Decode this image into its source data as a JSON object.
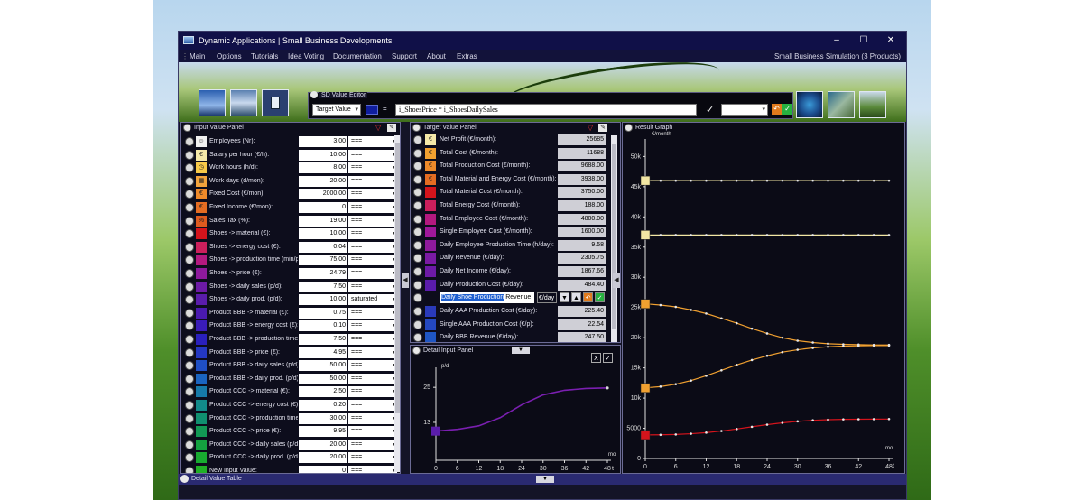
{
  "window": {
    "title": "Dynamic Applications | Small Business Developments",
    "minimize": "–",
    "maximize": "☐",
    "close": "✕"
  },
  "menu": {
    "items": [
      "Main",
      "Options",
      "Tutorials",
      "Idea Voting",
      "Documentation",
      "Support",
      "About",
      "Extras"
    ],
    "simulation": "Small Business Simulation  (3 Products)"
  },
  "sd_editor": {
    "label": "SD Value Editor",
    "target": "Target Value",
    "eq": "=",
    "formula": "i_ShoesPrice * i_ShoesDailySales",
    "check": "✓"
  },
  "input_panel": {
    "title": "Input Value Panel",
    "rows": [
      {
        "name": "Employees (Nr):",
        "value": "3.00",
        "op": "===",
        "color": "#f0f0f0",
        "glyph": "☺"
      },
      {
        "name": "Salary per hour (€/h):",
        "value": "10.00",
        "op": "===",
        "color": "#f5e9a8",
        "glyph": "€"
      },
      {
        "name": "Work hours (h/d):",
        "value": "8.00",
        "op": "===",
        "color": "#f7c948",
        "glyph": "◷"
      },
      {
        "name": "Work days (d/mon):",
        "value": "20.00",
        "op": "===",
        "color": "#f3a43c",
        "glyph": "▦"
      },
      {
        "name": "Fixed Cost (€/mon):",
        "value": "2000.00",
        "op": "===",
        "color": "#ee8a2a",
        "glyph": "€"
      },
      {
        "name": "Fixed Income (€/mon):",
        "value": "0",
        "op": "===",
        "color": "#e46c22",
        "glyph": "€"
      },
      {
        "name": "Sales Tax (%):",
        "value": "19.00",
        "op": "===",
        "color": "#dd5a1e",
        "glyph": "%"
      },
      {
        "name": "Shoes -> material (€):",
        "value": "10.00",
        "op": "===",
        "color": "#d4141c",
        "glyph": ""
      },
      {
        "name": "Shoes -> energy cost (€):",
        "value": "0.04",
        "op": "===",
        "color": "#cc1f5c",
        "glyph": ""
      },
      {
        "name": "Shoes -> production time (min/p",
        "value": "75.00",
        "op": "===",
        "color": "#b3197f",
        "glyph": ""
      },
      {
        "name": "Shoes -> price (€):",
        "value": "24.79",
        "op": "===",
        "color": "#8e1a9c",
        "glyph": ""
      },
      {
        "name": "Shoes -> daily sales (p/d):",
        "value": "7.50",
        "op": "===",
        "color": "#6d1aa6",
        "glyph": ""
      },
      {
        "name": "Shoes -> daily prod. (p/d):",
        "value": "10.00",
        "op": "saturated",
        "color": "#5a1cab",
        "glyph": ""
      },
      {
        "name": "Product BBB -> material (€):",
        "value": "0.75",
        "op": "===",
        "color": "#4a1ab0",
        "glyph": ""
      },
      {
        "name": "Product BBB -> energy cost (€):",
        "value": "0.10",
        "op": "===",
        "color": "#3a1cb8",
        "glyph": ""
      },
      {
        "name": "Product BBB -> production time",
        "value": "7.50",
        "op": "===",
        "color": "#2a20bd",
        "glyph": ""
      },
      {
        "name": "Product BBB -> price (€):",
        "value": "4.95",
        "op": "===",
        "color": "#2438c2",
        "glyph": ""
      },
      {
        "name": "Product BBB -> daily sales (p/d)",
        "value": "50.00",
        "op": "===",
        "color": "#1f4fc4",
        "glyph": ""
      },
      {
        "name": "Product BBB -> daily prod. (p/d)",
        "value": "50.00",
        "op": "===",
        "color": "#1a64c0",
        "glyph": ""
      },
      {
        "name": "Product CCC -> material (€):",
        "value": "2.50",
        "op": "===",
        "color": "#167aa8",
        "glyph": ""
      },
      {
        "name": "Product CCC -> energy cost (€):",
        "value": "0.20",
        "op": "===",
        "color": "#128a8a",
        "glyph": ""
      },
      {
        "name": "Product CCC -> production time",
        "value": "30.00",
        "op": "===",
        "color": "#109070",
        "glyph": ""
      },
      {
        "name": "Product CCC -> price (€):",
        "value": "9.95",
        "op": "===",
        "color": "#129a55",
        "glyph": ""
      },
      {
        "name": "Product CCC -> daily sales (p/d)",
        "value": "20.00",
        "op": "===",
        "color": "#14a240",
        "glyph": ""
      },
      {
        "name": "Product CCC -> daily prod. (p/d)",
        "value": "20.00",
        "op": "===",
        "color": "#18aa30",
        "glyph": ""
      },
      {
        "name": "New Input Value:",
        "value": "0",
        "op": "===",
        "color": "#20b026",
        "glyph": ""
      }
    ]
  },
  "target_panel": {
    "title": "Target Value Panel",
    "rows": [
      {
        "name": "Net Profit (€/month):",
        "value": "25685",
        "color": "#f5e9a8",
        "glyph": "€"
      },
      {
        "name": "Total Cost (€/month):",
        "value": "11688",
        "color": "#f0a030",
        "glyph": "€"
      },
      {
        "name": "Total Production Cost (€/month):",
        "value": "9688.00",
        "color": "#ee8a2a",
        "glyph": "€"
      },
      {
        "name": "Total Material and Energy Cost (€/month):",
        "value": "3938.00",
        "color": "#e46c22",
        "glyph": "€"
      },
      {
        "name": "Total Material Cost (€/month):",
        "value": "3750.00",
        "color": "#d4141c",
        "glyph": ""
      },
      {
        "name": "Total Energy Cost (€/month):",
        "value": "188.00",
        "color": "#cc1f5c",
        "glyph": ""
      },
      {
        "name": "Total Employee Cost (€/month):",
        "value": "4800.00",
        "color": "#b3197f",
        "glyph": ""
      },
      {
        "name": "Single Employee Cost (€/month):",
        "value": "1600.00",
        "color": "#a0189a",
        "glyph": ""
      },
      {
        "name": "Daily Employee Production Time (h/day):",
        "value": "9.58",
        "color": "#8e1a9c",
        "glyph": ""
      },
      {
        "name": "Daily Revenue (€/day):",
        "value": "2305.75",
        "color": "#7a1aa3",
        "glyph": ""
      },
      {
        "name": "Daily Net Income (€/day):",
        "value": "1867.66",
        "color": "#6d1aa6",
        "glyph": ""
      },
      {
        "name": "Daily Production Cost (€/day):",
        "value": "484.40",
        "color": "#5a1cab",
        "glyph": ""
      }
    ],
    "edit_row": {
      "highlight": "Daily Shoe Production",
      "rest": " Revenue",
      "unit": "€/day"
    },
    "rows2": [
      {
        "name": "Daily AAA Production Cost (€/day):",
        "value": "225.40",
        "color": "#2a3aba",
        "glyph": ""
      },
      {
        "name": "Single AAA Production Cost (€/p):",
        "value": "22.54",
        "color": "#2448c0",
        "glyph": ""
      },
      {
        "name": "Daily BBB Revenue (€/day):",
        "value": "247.50",
        "color": "#1f56c4",
        "glyph": ""
      }
    ]
  },
  "detail_input": {
    "title": "Detail Input Panel",
    "btn_x": "X",
    "btn_check": "✓",
    "unit": "p/d",
    "x_unit": "mo",
    "x_var": "t",
    "y_ticks": [
      "25",
      "13"
    ],
    "x_ticks": [
      "0",
      "6",
      "12",
      "18",
      "24",
      "30",
      "36",
      "42",
      "48"
    ]
  },
  "result_graph": {
    "title": "Result Graph",
    "unit": "€/month",
    "x_unit": "mo",
    "x_var": "t",
    "y_ticks": [
      "50k",
      "45k",
      "40k",
      "35k",
      "30k",
      "25k",
      "20k",
      "15k",
      "10k",
      "5000",
      "0"
    ],
    "x_ticks": [
      "0",
      "6",
      "12",
      "18",
      "24",
      "30",
      "36",
      "42",
      "48"
    ]
  },
  "chart_data": [
    {
      "type": "line",
      "title": "",
      "ylabel": "p/d",
      "xlabel": "mo",
      "ylim": [
        0,
        30
      ],
      "xlim": [
        0,
        48
      ],
      "series": [
        {
          "color": "#7a1fb0",
          "x": [
            0,
            6,
            12,
            18,
            24,
            30,
            36,
            42,
            48
          ],
          "y": [
            10.0,
            10.6,
            11.8,
            14.6,
            19.0,
            22.4,
            24.0,
            24.6,
            24.8
          ]
        }
      ]
    },
    {
      "type": "line",
      "title": "",
      "ylabel": "€/month",
      "xlabel": "mo",
      "ylim": [
        0,
        52000
      ],
      "xlim": [
        0,
        48
      ],
      "series": [
        {
          "color": "#f2e6a3",
          "x": [
            0,
            3,
            6,
            9,
            12,
            15,
            18,
            21,
            24,
            27,
            30,
            33,
            36,
            39,
            42,
            45,
            48
          ],
          "y": [
            46000,
            46000,
            46000,
            46000,
            46000,
            46000,
            46000,
            46000,
            46000,
            46000,
            46000,
            46000,
            46000,
            46000,
            46000,
            46000,
            46000
          ]
        },
        {
          "color": "#f2e6a3",
          "x": [
            0,
            3,
            6,
            9,
            12,
            15,
            18,
            21,
            24,
            27,
            30,
            33,
            36,
            39,
            42,
            45,
            48
          ],
          "y": [
            37000,
            37000,
            37000,
            37000,
            37000,
            37000,
            37000,
            37000,
            37000,
            37000,
            37000,
            37000,
            37000,
            37000,
            37000,
            37000,
            37000
          ]
        },
        {
          "color": "#f0a030",
          "x": [
            0,
            3,
            6,
            9,
            12,
            15,
            18,
            21,
            24,
            27,
            30,
            33,
            36,
            39,
            42,
            45,
            48
          ],
          "y": [
            25600,
            25400,
            25100,
            24600,
            24000,
            23200,
            22400,
            21500,
            20700,
            20000,
            19500,
            19200,
            19000,
            18900,
            18850,
            18800,
            18800
          ]
        },
        {
          "color": "#f0a030",
          "x": [
            0,
            3,
            6,
            9,
            12,
            15,
            18,
            21,
            24,
            27,
            30,
            33,
            36,
            39,
            42,
            45,
            48
          ],
          "y": [
            11700,
            11900,
            12300,
            12900,
            13700,
            14600,
            15500,
            16300,
            17000,
            17600,
            18000,
            18300,
            18500,
            18600,
            18650,
            18700,
            18700
          ]
        },
        {
          "color": "#d4141c",
          "x": [
            0,
            3,
            6,
            9,
            12,
            15,
            18,
            21,
            24,
            27,
            30,
            33,
            36,
            39,
            42,
            45,
            48
          ],
          "y": [
            3900,
            3920,
            3980,
            4100,
            4280,
            4550,
            4880,
            5250,
            5600,
            5900,
            6150,
            6320,
            6420,
            6480,
            6500,
            6520,
            6530
          ]
        }
      ]
    }
  ],
  "footer": {
    "title": "Detail Value Table"
  }
}
